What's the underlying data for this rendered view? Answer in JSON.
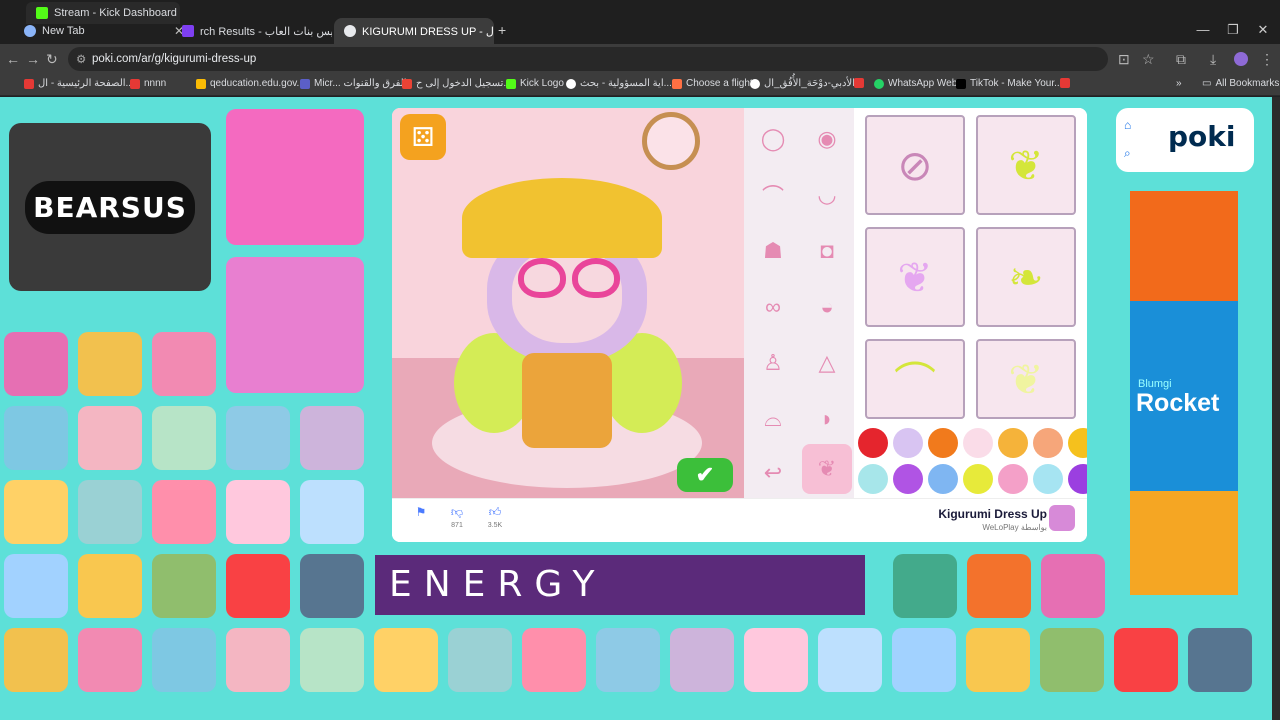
{
  "browser": {
    "tabs_top": [
      {
        "title": "Stream - Kick Dashboard",
        "favicon_color": "#53fc18"
      },
      {
        "title": "New Tab",
        "favicon_color": "#8ab4f8"
      }
    ],
    "tabs_main": [
      {
        "title": "New Tab",
        "favicon_color": "#8ab4f8"
      },
      {
        "title": "rch Results - تلبيس بنات العاب",
        "favicon_color": "#7e3ff2"
      },
      {
        "title": "KIGURUMI DRESS UP - ال...",
        "favicon_color": "#e8eaed"
      }
    ],
    "new_tab": "+",
    "url": "poki.com/ar/g/kigurumi-dress-up",
    "bookmarks": [
      {
        "label": "الصفحة الرئيسية - ال...",
        "color": "#e53935"
      },
      {
        "label": "nnnn",
        "color": "#e53935"
      },
      {
        "label": "qeducation.edu.gov...",
        "color": "#fbbc05"
      },
      {
        "label": "Micr... الفرق والقنوات",
        "color": "#5b5fc7"
      },
      {
        "label": "تسجيل الدخول إلى ح...",
        "color": "#ea4335"
      },
      {
        "label": "Kick Logo",
        "color": "#53fc18"
      },
      {
        "label": "اية المسؤولية - بحث...",
        "color": "#ffffff"
      },
      {
        "label": "Choose a flight",
        "color": "#ff7043"
      },
      {
        "label": "الأدبي-دوْحَة_الأُفُق_ال...",
        "color": "#ffffff"
      },
      {
        "label": "",
        "color": "#e53935"
      },
      {
        "label": "WhatsApp Web",
        "color": "#25d366"
      },
      {
        "label": "TikTok - Make Your...",
        "color": "#000000"
      },
      {
        "label": "",
        "color": "#e53935"
      }
    ],
    "all_bookmarks": "All Bookmarks"
  },
  "page": {
    "featured_game": "BEARSUS",
    "game": {
      "title": "Kigurumi Dress Up",
      "publisher": "WeLoPlay بواسطة",
      "likes": "871",
      "dislikes": "3.5K",
      "swatches_row1": [
        "#e5252d",
        "#d8c4f2",
        "#f17a1c",
        "#fadce8",
        "#f5b33a",
        "#f6a67a",
        "#f5c11d"
      ],
      "swatches_row2": [
        "#a7e6ea",
        "#b054e4",
        "#7fb6f2",
        "#e7ea3a",
        "#f4a0c8",
        "#a6e4f2",
        "#9b3fe0"
      ]
    },
    "logo": "poki",
    "ad": {
      "small": "Blumgi",
      "title": "Rocket"
    },
    "banner": "ENERGY"
  }
}
